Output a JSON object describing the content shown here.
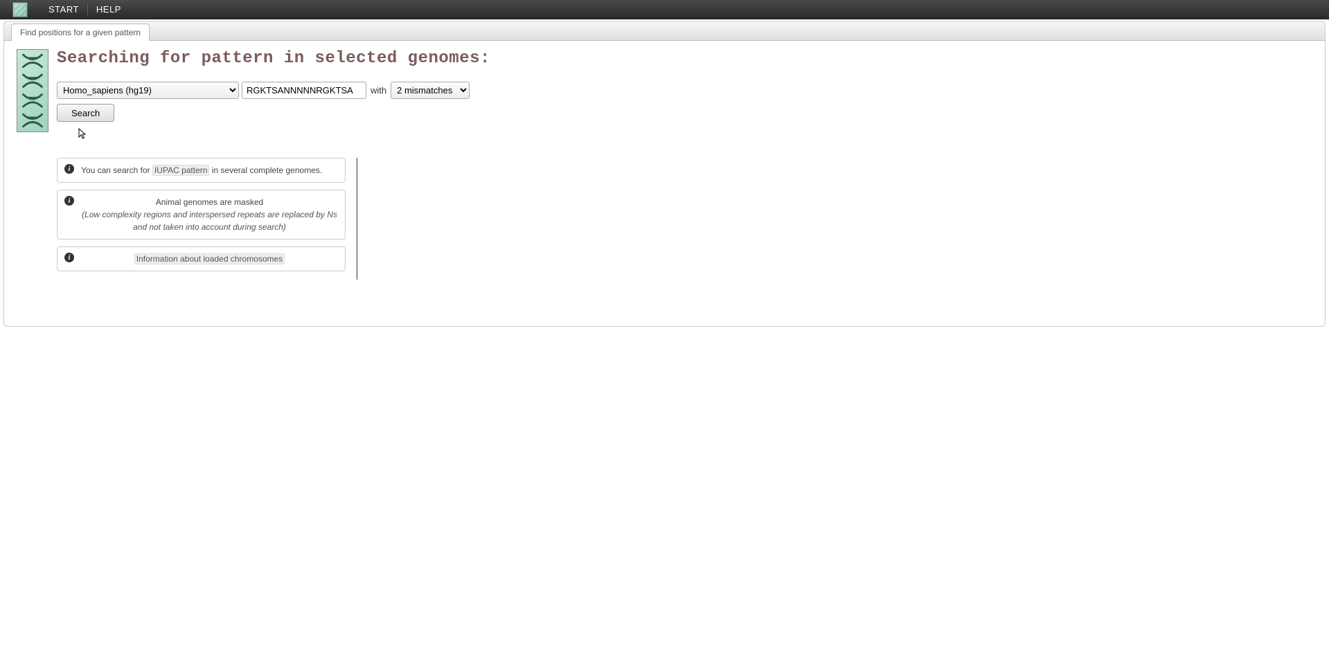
{
  "topbar": {
    "start_label": "START",
    "help_label": "HELP"
  },
  "tab": {
    "label": "Find positions for a given pattern"
  },
  "page": {
    "title": "Searching for pattern in selected genomes:"
  },
  "form": {
    "genome_selected": "Homo_sapiens (hg19)",
    "pattern_value": "RGKTSANNNNNRGKTSA",
    "with_label": "with",
    "mismatches_selected": "2 mismatches",
    "search_button": "Search"
  },
  "info": {
    "box1_prefix": "You can search for ",
    "box1_link": "IUPAC pattern",
    "box1_suffix": " in several complete genomes.",
    "box2_title": "Animal genomes are masked",
    "box2_note": "(Low complexity regions and interspersed repeats are replaced by Ns and not taken into account during search)",
    "box3_link": "Information about loaded chromosomes"
  }
}
